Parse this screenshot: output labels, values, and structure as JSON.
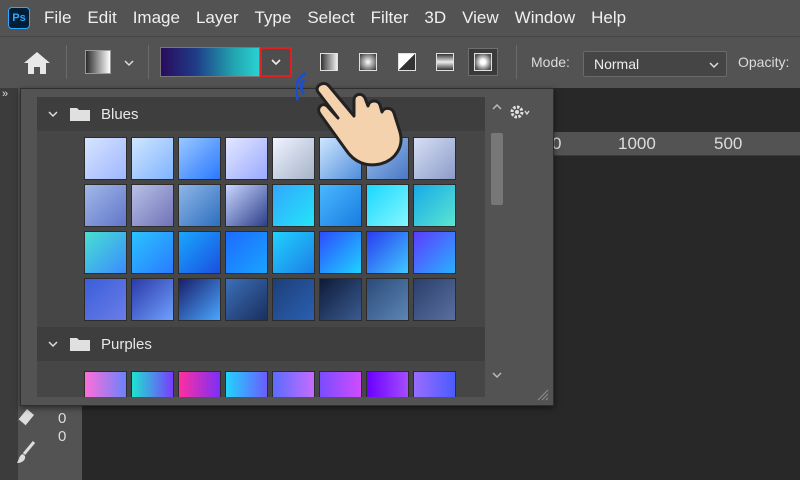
{
  "app": {
    "logo_text": "Ps"
  },
  "menu": [
    "File",
    "Edit",
    "Image",
    "Layer",
    "Type",
    "Select",
    "Filter",
    "3D",
    "View",
    "Window",
    "Help"
  ],
  "options": {
    "mode_label": "Mode:",
    "mode_value": "Normal",
    "opacity_label": "Opacity:"
  },
  "ruler": {
    "top_labels": [
      "0",
      "1000",
      "500"
    ],
    "left_labels": [
      "0",
      "0"
    ]
  },
  "panel": {
    "groups": [
      {
        "name": "Blues",
        "swatches": [
          [
            "#d6e4ff",
            "#9fb7ff"
          ],
          [
            "#d0e6ff",
            "#7fb3ff"
          ],
          [
            "#9ac8ff",
            "#2a78ff"
          ],
          [
            "#e3e8ff",
            "#9aa9ff"
          ],
          [
            "#f0f4ff",
            "#a5b3c8"
          ],
          [
            "#cfe6ff",
            "#4f8edb"
          ],
          [
            "#9cc2ee",
            "#4a77c4"
          ],
          [
            "#d7dff5",
            "#8c9cc8"
          ],
          [
            "#a2b8e8",
            "#6076c9"
          ],
          [
            "#b9c0e6",
            "#6f73b8"
          ],
          [
            "#8fb6e6",
            "#2c6fbf"
          ],
          [
            "#c9d6ff",
            "#2c3f8a"
          ],
          [
            "#33a6ff",
            "#23e5f7"
          ],
          [
            "#49b7ff",
            "#1a7de0"
          ],
          [
            "#1ad7ff",
            "#86f7ff"
          ],
          [
            "#17aae8",
            "#5ae6d1"
          ],
          [
            "#47e0d0",
            "#3b8bff"
          ],
          [
            "#2ac3ff",
            "#2a7bff"
          ],
          [
            "#19a7ff",
            "#1a4fe0"
          ],
          [
            "#1d6bff",
            "#1aa3ff"
          ],
          [
            "#21d1ff",
            "#1c7fe6"
          ],
          [
            "#2c4dff",
            "#1ed2ff"
          ],
          [
            "#2a3cf0",
            "#3ec9ff"
          ],
          [
            "#5a3cff",
            "#2ab0ff"
          ],
          [
            "#3b5ed8",
            "#6a7de8"
          ],
          [
            "#2b3aa8",
            "#6fa0ff"
          ],
          [
            "#1a1f6b",
            "#4aa6ff"
          ],
          [
            "#3c6fb8",
            "#1a2f5f"
          ],
          [
            "#1d3f7a",
            "#2a5fb0"
          ],
          [
            "#0e1b3a",
            "#3b5b8f"
          ],
          [
            "#2b4b7a",
            "#5d86b4"
          ],
          [
            "#2a3f6a",
            "#5a6fa0"
          ]
        ]
      },
      {
        "name": "Purples",
        "swatches": [
          [
            "#ff6fd8",
            "#6a82fb"
          ],
          [
            "#1ee3cf",
            "#7a3cff"
          ],
          [
            "#ff2fa0",
            "#7b2ff7"
          ],
          [
            "#21d4fd",
            "#6a5cff"
          ],
          [
            "#5a6cff",
            "#c56cff"
          ],
          [
            "#7a4cff",
            "#d04cff"
          ],
          [
            "#6a00ff",
            "#a54cff"
          ],
          [
            "#9a6cff",
            "#4a5cff"
          ]
        ]
      }
    ]
  },
  "colors": {
    "accent_red": "#e02020",
    "menubar": "#535353",
    "canvas": "#282828"
  }
}
